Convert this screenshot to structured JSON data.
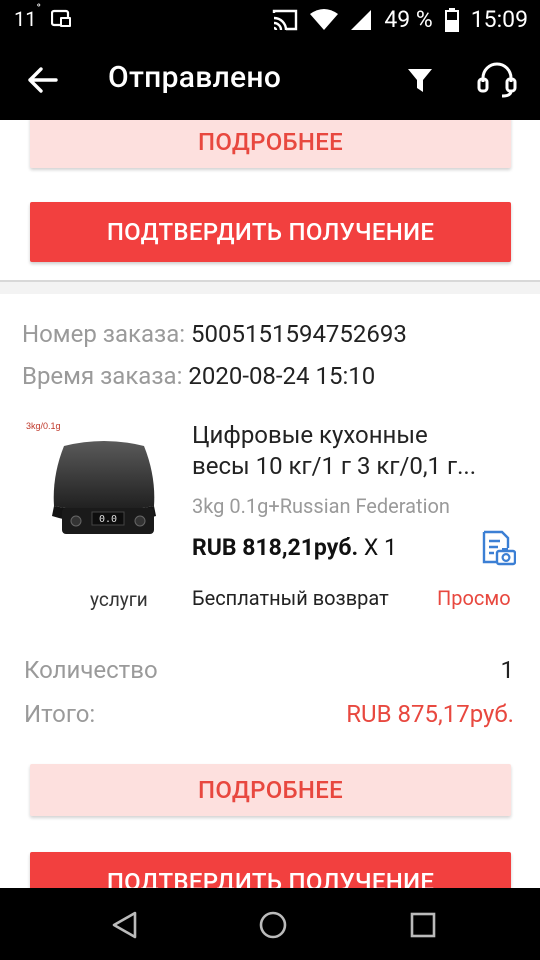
{
  "status_bar": {
    "temperature": "11",
    "degree": "°",
    "battery_percent": "49 %",
    "time": "15:09"
  },
  "toolbar": {
    "title": "Отправлено"
  },
  "buttons": {
    "details_label": "ПОДРОБНЕЕ",
    "confirm_label": "ПОДТВЕРДИТЬ ПОЛУЧЕНИЕ"
  },
  "order": {
    "number_label": "Номер заказа:",
    "number_value": "5005151594752693",
    "time_label": "Время заказа:",
    "time_value": "2020-08-24 15:10",
    "product": {
      "image_tag": "3kg/0.1g",
      "display_text": "0.0",
      "name_line1": "Цифровые кухонные",
      "name_line2": "весы 10 кг/1 г 3 кг/0,1 г...",
      "variant": "3kg  0.1g+Russian Federation",
      "price": "RUB 818,21руб.",
      "quantity_suffix": "X 1"
    },
    "services_label": "услуги",
    "free_return": "Бесплатный возврат",
    "view_link": "Просмо",
    "quantity_label": "Количество",
    "quantity_value": "1",
    "total_label": "Итого:",
    "total_value": "RUB 875,17руб."
  }
}
